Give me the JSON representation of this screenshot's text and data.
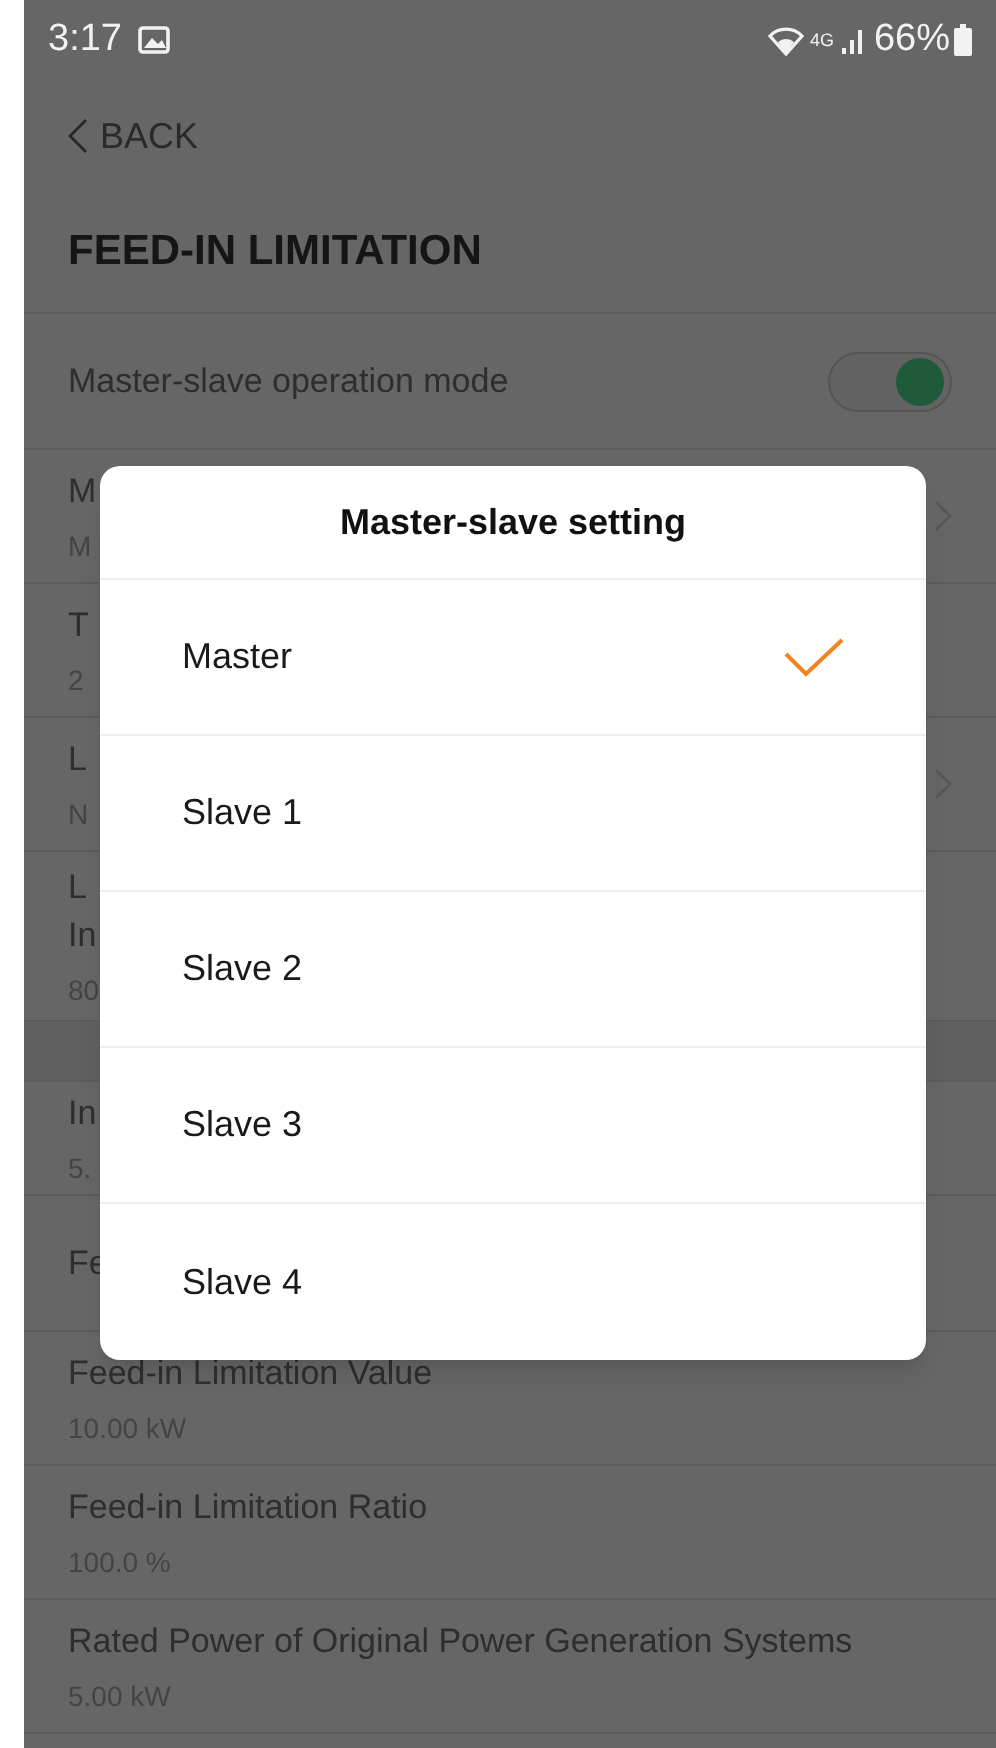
{
  "status_bar": {
    "time": "3:17",
    "network": "4G",
    "battery": "66%"
  },
  "back": {
    "label": "BACK"
  },
  "title": "FEED-IN LIMITATION",
  "rows": [
    {
      "kind": "toggle",
      "label": "Master-slave operation mode",
      "on": true
    },
    {
      "kind": "link",
      "label": "M",
      "value": "M"
    },
    {
      "kind": "plain",
      "label": "T",
      "value": "2"
    },
    {
      "kind": "link",
      "label": "L",
      "value": "N"
    },
    {
      "kind": "plain",
      "label": "L",
      "label_2": "In",
      "value": "80"
    },
    {
      "kind": "gap"
    },
    {
      "kind": "plain",
      "label": "In",
      "value": "5."
    },
    {
      "kind": "plain",
      "label": "Fe"
    },
    {
      "kind": "plain",
      "label": "Feed-in Limitation Value",
      "value": "10.00 kW"
    },
    {
      "kind": "plain",
      "label": "Feed-in Limitation Ratio",
      "value": "100.0 %"
    },
    {
      "kind": "plain",
      "label": "Rated Power of Original Power Generation Systems",
      "value": "5.00 kW"
    }
  ],
  "dialog": {
    "title": "Master-slave setting",
    "options": [
      {
        "label": "Master",
        "selected": true
      },
      {
        "label": "Slave 1",
        "selected": false
      },
      {
        "label": "Slave 2",
        "selected": false
      },
      {
        "label": "Slave 3",
        "selected": false
      },
      {
        "label": "Slave 4",
        "selected": false
      }
    ]
  }
}
